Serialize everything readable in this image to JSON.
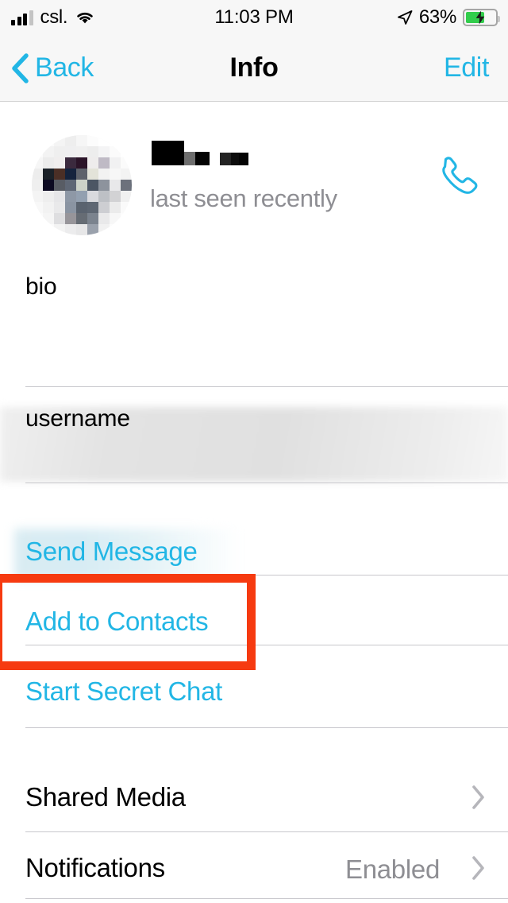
{
  "status_bar": {
    "carrier": "csl.",
    "wifi_icon": "wifi-icon",
    "time": "11:03 PM",
    "location_icon": "location-arrow-icon",
    "battery_percent": "63%",
    "battery_level": 63,
    "battery_charging": true
  },
  "nav_bar": {
    "back_label": "Back",
    "back_icon": "chevron-left-icon",
    "title": "Info",
    "edit_label": "Edit"
  },
  "profile": {
    "avatar_icon": "pixelated-avatar-image",
    "name": "",
    "name_redacted": true,
    "status": "last seen recently",
    "call_icon": "phone-call-icon"
  },
  "fields": [
    {
      "label": "bio",
      "value": "",
      "redacted": true,
      "redaction_style": "gray-blur"
    },
    {
      "label": "username",
      "value": "",
      "redacted": true,
      "redaction_style": "blue-blur"
    }
  ],
  "actions": [
    {
      "label": "Send Message",
      "highlighted": false
    },
    {
      "label": "Add to Contacts",
      "highlighted": true
    },
    {
      "label": "Start Secret Chat",
      "highlighted": false
    }
  ],
  "settings_rows": [
    {
      "label": "Shared Media",
      "value": "",
      "chevron_icon": "chevron-right-icon"
    },
    {
      "label": "Notifications",
      "value": "Enabled",
      "chevron_icon": "chevron-right-icon"
    }
  ],
  "colors": {
    "accent": "#22b6e5",
    "highlight": "#f63a10",
    "secondary_text": "#8e8e93",
    "separator": "#c8c7cc",
    "battery_green": "#32cd4c"
  }
}
